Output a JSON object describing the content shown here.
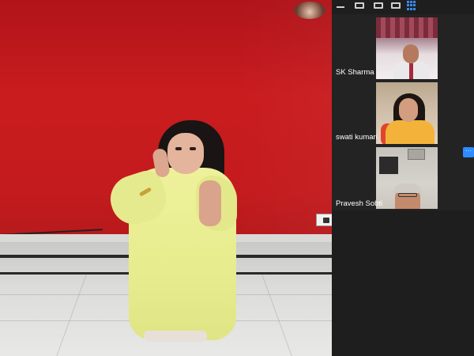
{
  "meeting": {
    "toolbar": {
      "icons": [
        "minimize-icon",
        "speaker-view-icon",
        "gallery-view-icon",
        "side-by-side-icon",
        "grid-view-icon"
      ],
      "active_color": "#3a8af5"
    },
    "participants": [
      {
        "name": "SK Sharma"
      },
      {
        "name": "swati kumari"
      },
      {
        "name": "Pravesh Sobti",
        "more_label": "···"
      }
    ],
    "colors": {
      "panel_bg": "#1e1e1e",
      "tile_bg": "#232323",
      "accent": "#2d8cff",
      "wall": "#c21a1c"
    }
  }
}
